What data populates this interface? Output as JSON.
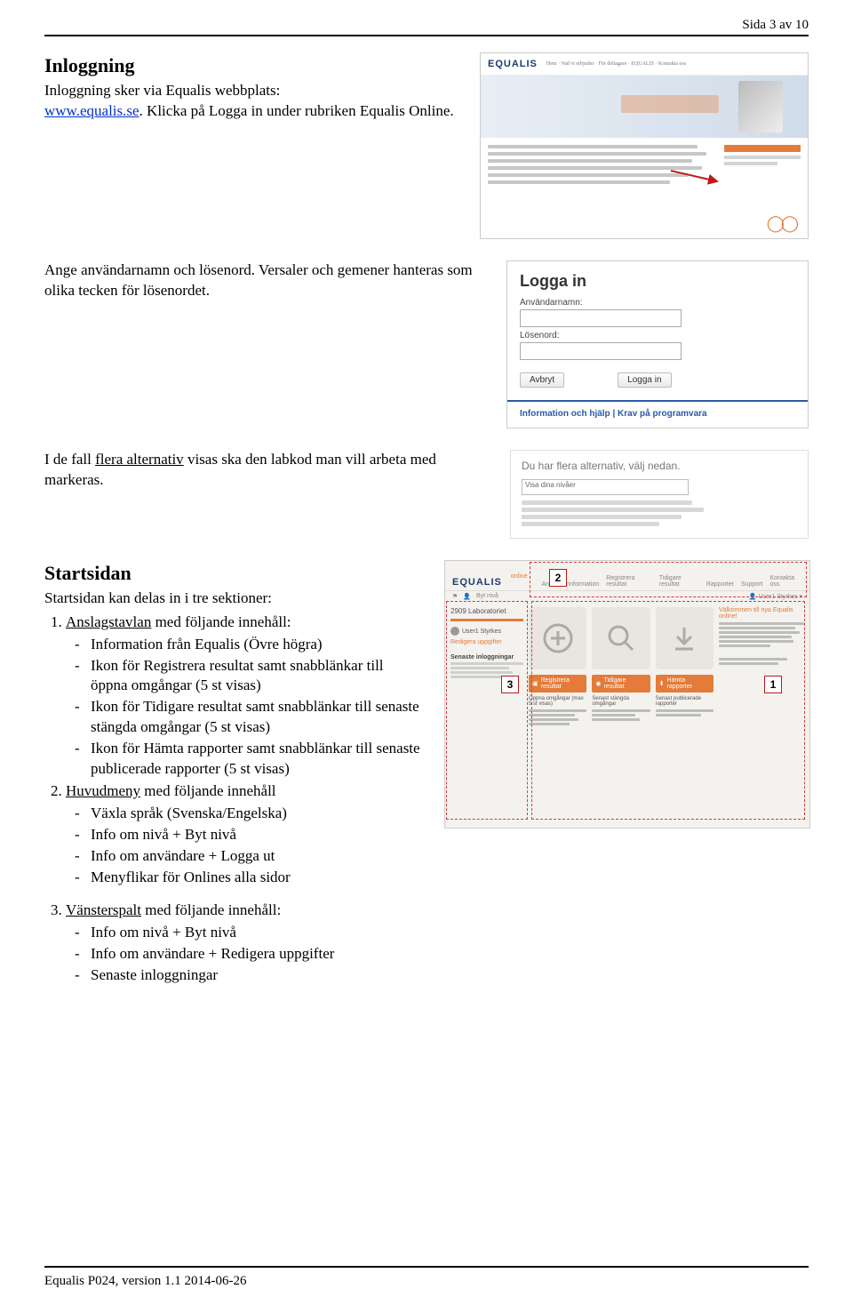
{
  "header": {
    "page_indicator": "Sida 3 av 10"
  },
  "section1": {
    "title": "Inloggning",
    "line1": "Inloggning sker via Equalis webbplats:",
    "link": "www.equalis.se",
    "line2a": ". Klicka på Logga in under rubriken Equalis Online.",
    "p2": "Ange användarnamn och lösenord. Versaler och gemener hanteras som olika tecken för lösenordet.",
    "p3a": "I de fall ",
    "p3u": "flera alternativ",
    "p3b": " visas ska den labkod man vill arbeta med markeras."
  },
  "login_mock": {
    "title": "Logga in",
    "user_lbl": "Användarnamn:",
    "pass_lbl": "Lösenord:",
    "cancel": "Avbryt",
    "submit": "Logga in",
    "footer": "Information och hjälp | Krav på programvara"
  },
  "alt_mock": {
    "title": "Du har flera alternativ, välj nedan.",
    "select_text": "Visa dina nivåer"
  },
  "section2": {
    "title": "Startsidan",
    "intro": "Startsidan kan delas in i tre sektioner:",
    "item1_lead": "Anslagstavlan",
    "item1_tail": " med följande innehåll:",
    "i1a": "Information från Equalis (Övre högra)",
    "i1b": "Ikon för Registrera resultat samt snabblänkar till öppna omgångar (5 st visas)",
    "i1c": "Ikon för Tidigare resultat samt snabblänkar till senaste stängda omgångar (5 st visas)",
    "i1d": "Ikon för Hämta rapporter samt snabblänkar till senaste publicerade rapporter (5 st visas)",
    "item2_lead": "Huvudmeny",
    "item2_tail": " med följande innehåll",
    "i2a": "Växla språk (Svenska/Engelska)",
    "i2b": "Info om nivå + Byt nivå",
    "i2c": "Info om användare + Logga ut",
    "i2d": "Menyflikar för Onlines alla sidor",
    "item3_lead": "Vänsterspalt",
    "item3_tail": " med följande innehåll:",
    "i3a": "Info om nivå + Byt nivå",
    "i3b": "Info om användare + Redigera uppgifter",
    "i3c": "Senaste inloggningar"
  },
  "start_mock": {
    "brand": "EQUALIS",
    "brand_sub": "online",
    "nav1": "Användarinformation",
    "nav2": "Registrera resultat",
    "nav3": "Tidigare resultat",
    "nav4": "Rapporter",
    "nav5": "Support",
    "nav6": "Kontakta oss",
    "pill": "Byt nivå",
    "lab_id": "2909 Laboratoriet",
    "user_name": "User1 Styrkes",
    "left_link": "Redigera uppgifter",
    "left_block": "Senaste inloggningar",
    "welcome": "Välkommen till nya Equalis online!",
    "btn1": "Registrera resultat",
    "btn2": "Tidigare resultat",
    "btn3": "Hämta rapporter",
    "col1h": "Öppna omgångar (max 5 st visas)",
    "col2h": "Senast stängda omgångar",
    "col3h": "Senast publicerade rapporter",
    "label1": "1",
    "label2": "2",
    "label3": "3"
  },
  "footer": {
    "text": "Equalis P024, version 1.1 2014-06-26"
  }
}
